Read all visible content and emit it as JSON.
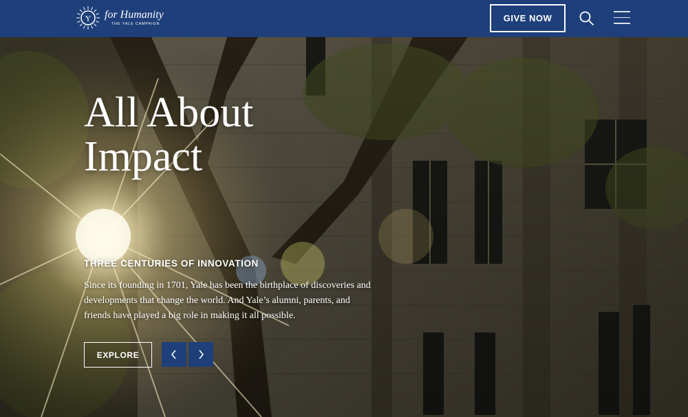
{
  "header": {
    "logo_title": "for Humanity",
    "logo_subtitle": "THE YALE CAMPAIGN",
    "logo_seal_letter": "Y",
    "give_label": "GIVE NOW",
    "search_icon": "search-icon",
    "menu_icon": "hamburger-menu-icon"
  },
  "hero": {
    "title_line1": "All About",
    "title_line2": "Impact",
    "eyebrow": "THREE CENTURIES OF INNOVATION",
    "description": "Since its founding in 1701, Yale has been the birthplace of discoveries and developments that change the world. And Yale’s alumni, parents, and friends have played a big role in making it all possible.",
    "explore_label": "EXPLORE",
    "prev_icon": "chevron-left-icon",
    "next_icon": "chevron-right-icon"
  },
  "colors": {
    "brand_blue": "#1e3f7a",
    "text": "#ffffff"
  }
}
